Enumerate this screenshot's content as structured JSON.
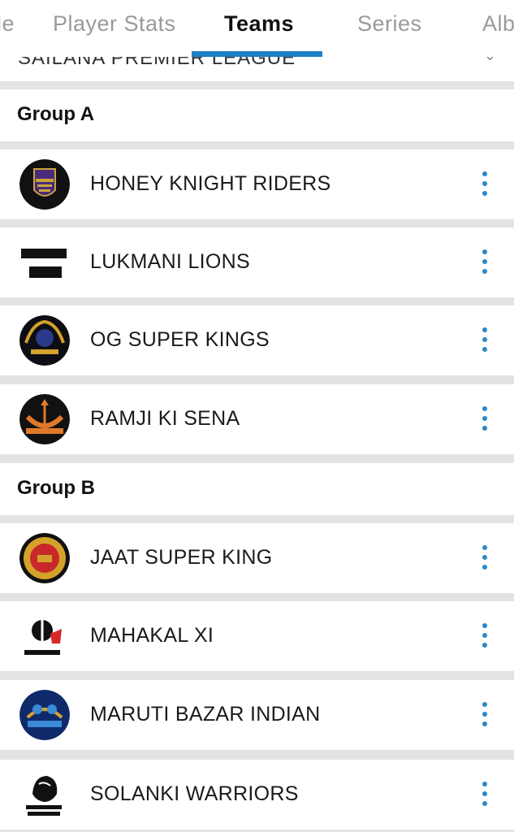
{
  "tabs": [
    {
      "label": "le"
    },
    {
      "label": "Player Stats"
    },
    {
      "label": "Teams",
      "active": true
    },
    {
      "label": "Series"
    },
    {
      "label": "Alb"
    }
  ],
  "league": {
    "name": "SAILANA PREMIER LEAGUE"
  },
  "groups": [
    {
      "title": "Group A",
      "teams": [
        {
          "name": "HONEY KNIGHT RIDERS",
          "logo_icon": "honey-knight-riders-logo"
        },
        {
          "name": "LUKMANI LIONS",
          "logo_icon": "lukmani-lions-logo"
        },
        {
          "name": "OG SUPER KINGS",
          "logo_icon": "og-super-kings-logo"
        },
        {
          "name": "RAMJI KI SENA",
          "logo_icon": "ramji-ki-sena-logo"
        }
      ]
    },
    {
      "title": "Group B",
      "teams": [
        {
          "name": "JAAT SUPER KING",
          "logo_icon": "jaat-super-king-logo"
        },
        {
          "name": "MAHAKAL XI",
          "logo_icon": "mahakal-xi-logo"
        },
        {
          "name": "MARUTI BAZAR INDIAN",
          "logo_icon": "maruti-bazar-indian-logo"
        },
        {
          "name": "SOLANKI WARRIORS",
          "logo_icon": "solanki-warriors-logo"
        }
      ]
    }
  ],
  "colors": {
    "accent": "#1f7fc7",
    "menu_dots": "#2a87c8",
    "separator": "#e3e3e3",
    "tab_inactive": "#9a9a9a"
  }
}
